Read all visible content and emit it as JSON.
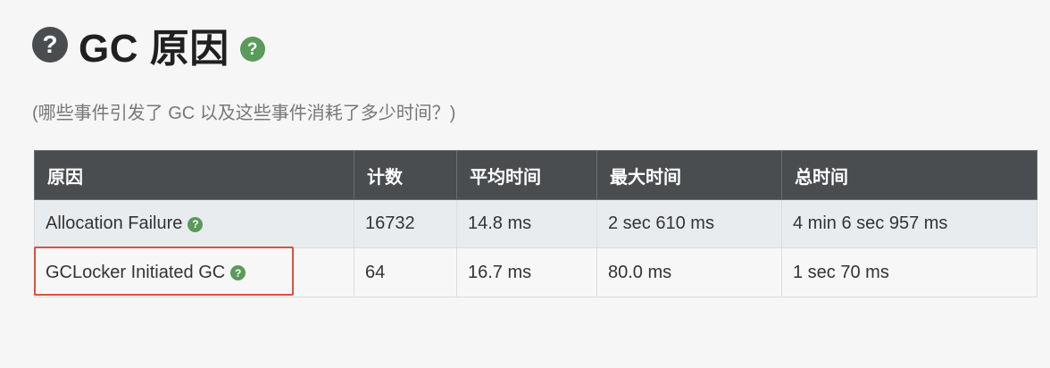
{
  "header": {
    "help_icon": "question-circle-icon",
    "title": "GC 原因",
    "info_icon": "question-circle-icon",
    "info_icon_color": "#5a9a5a"
  },
  "subtitle": "(哪些事件引发了 GC 以及这些事件消耗了多少时间？)",
  "table": {
    "header_bg": "#4a4d50",
    "columns": [
      "原因",
      "计数",
      "平均时间",
      "最大时间",
      "总时间"
    ],
    "rows": [
      {
        "cause": "Allocation Failure",
        "count": "16732",
        "avg": "14.8 ms",
        "max": "2 sec 610 ms",
        "total": "4 min 6 sec 957 ms"
      },
      {
        "cause": "GCLocker Initiated GC",
        "count": "64",
        "avg": "16.7 ms",
        "max": "80.0 ms",
        "total": "1 sec 70 ms"
      }
    ]
  },
  "highlight_color": "#e0503a"
}
